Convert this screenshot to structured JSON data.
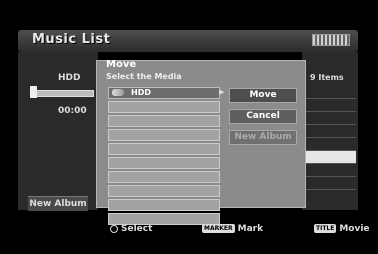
{
  "screen": {
    "title": "Music List"
  },
  "left": {
    "drive": "HDD",
    "time": "00:00",
    "new_album": "New Album",
    "progress": 0.06
  },
  "right": {
    "items_count": "9 Items"
  },
  "dialog": {
    "title": "Move",
    "subtitle": "Select the Media",
    "media": [
      "HDD",
      "",
      "",
      "",
      "",
      "",
      "",
      "",
      "",
      ""
    ],
    "buttons": {
      "move": "Move",
      "cancel": "Cancel",
      "new_album": "New Album"
    }
  },
  "footer": {
    "select": "Select",
    "mark_key": "MARKER",
    "mark": "Mark",
    "movie_key": "TITLE",
    "movie": "Movie"
  }
}
